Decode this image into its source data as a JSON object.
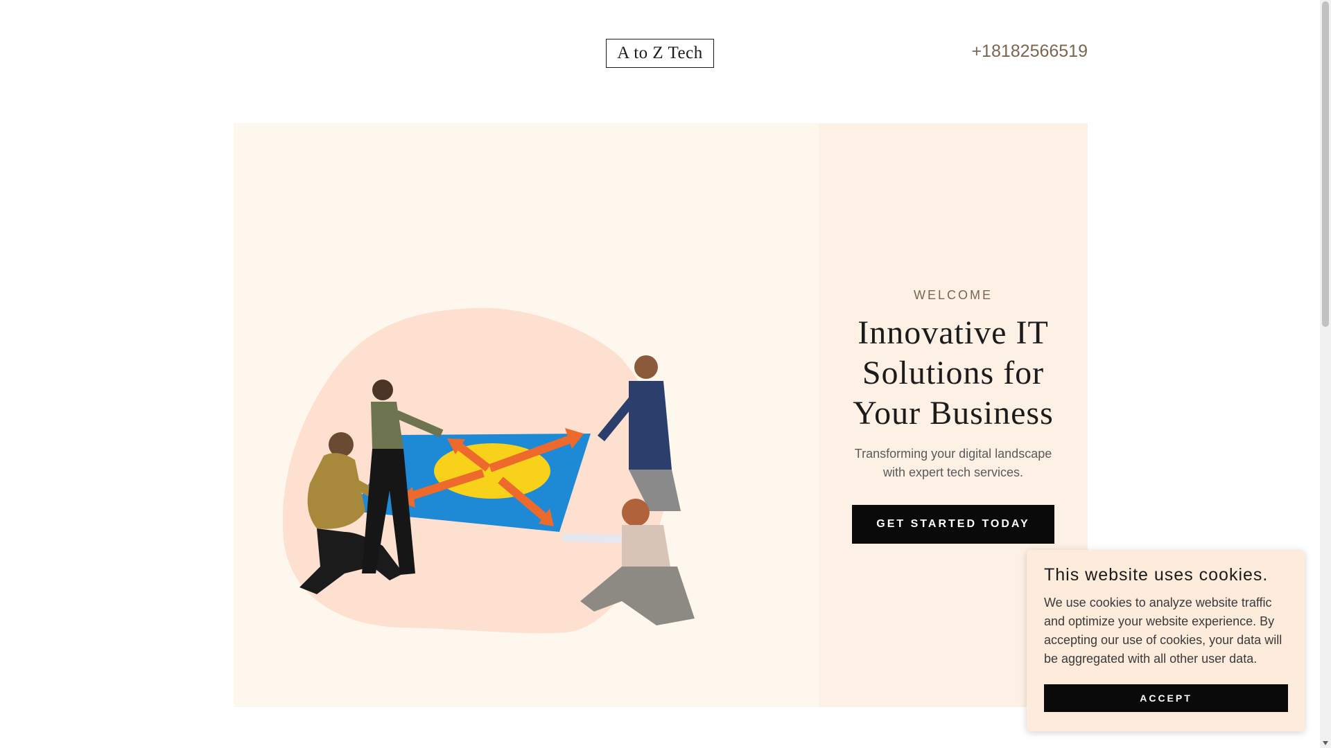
{
  "header": {
    "brand": "A to Z Tech",
    "phone": "+18182566519"
  },
  "hero": {
    "eyebrow": "WELCOME",
    "title": "Innovative IT Solutions for Your Business",
    "subtitle": "Transforming your digital landscape with expert tech services.",
    "cta_label": "GET STARTED TODAY",
    "image_alt": "Four people pulling a blue sheet with yellow circle and orange arrows"
  },
  "cookie_banner": {
    "title": "This website uses cookies.",
    "text": "We use cookies to analyze website traffic and optimize your website experience. By accepting our use of cookies, your data will be aggregated with all other user data.",
    "accept_label": "ACCEPT"
  },
  "colors": {
    "accent_text": "#7a6650",
    "hero_image_bg": "#fdf7ee",
    "hero_content_bg": "#fdf0e4",
    "blob": "#fde0d0",
    "button": "#0a0a0a",
    "cookie_bg": "#fdebdc"
  }
}
